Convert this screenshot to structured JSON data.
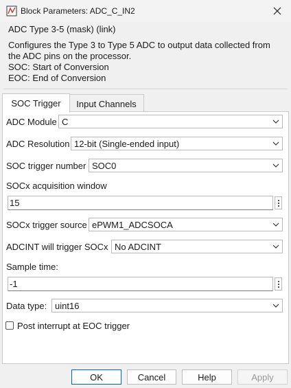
{
  "window": {
    "title": "Block Parameters: ADC_C_IN2"
  },
  "description": {
    "heading": "ADC Type 3-5 (mask) (link)",
    "lines": [
      "Configures the Type 3 to Type 5 ADC to output data collected from",
      "the ADC pins on the processor.",
      "SOC: Start of Conversion",
      "EOC: End of Conversion"
    ]
  },
  "tabs": [
    {
      "label": "SOC Trigger",
      "active": true
    },
    {
      "label": "Input Channels",
      "active": false
    }
  ],
  "params": {
    "adc_module": {
      "label": "ADC Module",
      "value": "C"
    },
    "adc_resolution": {
      "label": "ADC Resolution",
      "value": "12-bit (Single-ended input)"
    },
    "soc_trigger_number": {
      "label": "SOC trigger number",
      "value": "SOC0"
    },
    "acquisition_window": {
      "label": "SOCx acquisition window",
      "value": "15"
    },
    "trigger_source": {
      "label": "SOCx trigger source",
      "value": "ePWM1_ADCSOCA"
    },
    "adcint_trigger": {
      "label": "ADCINT will trigger SOCx",
      "value": "No ADCINT"
    },
    "sample_time": {
      "label": "Sample time:",
      "value": "-1"
    },
    "data_type": {
      "label": "Data type:",
      "value": "uint16"
    },
    "post_interrupt": {
      "label": "Post interrupt at EOC trigger",
      "checked": false
    }
  },
  "buttons": {
    "ok": "OK",
    "cancel": "Cancel",
    "help": "Help",
    "apply": "Apply"
  },
  "colors": {
    "primary_border": "#0067c0",
    "disabled_text": "#9a9a9a"
  },
  "icons": [
    "simulink-block-icon",
    "close-icon",
    "chevron-down-icon",
    "kebab-menu-icon"
  ]
}
